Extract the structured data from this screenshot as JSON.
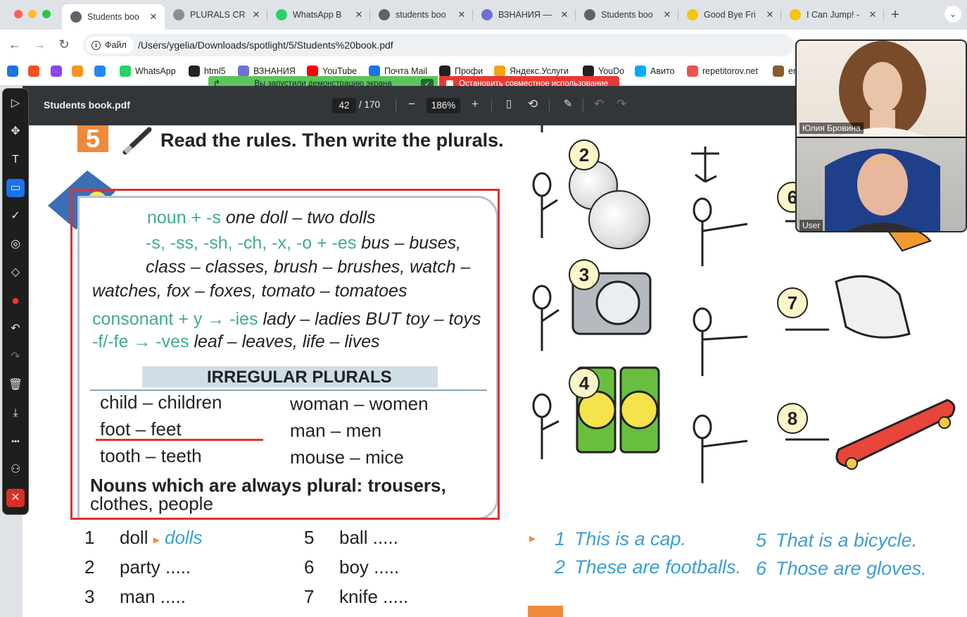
{
  "browser": {
    "tabs": [
      {
        "title": "Students boo",
        "favicon": "globe-icon",
        "color": "#5f6368",
        "active": true
      },
      {
        "title": "PLURALS CR",
        "favicon": "slides-icon",
        "color": "#8a8d91",
        "active": false
      },
      {
        "title": "WhatsApp B",
        "favicon": "whatsapp-icon",
        "color": "#25d366",
        "active": false
      },
      {
        "title": "students boo",
        "favicon": "globe-icon",
        "color": "#5f6368",
        "active": false
      },
      {
        "title": "ВЗНАНИЯ —",
        "favicon": "vznaniya-icon",
        "color": "#6f6fd8",
        "active": false
      },
      {
        "title": "Students boo",
        "favicon": "globe-icon",
        "color": "#5f6368",
        "active": false
      },
      {
        "title": "Good Bye Fri",
        "favicon": "play-icon",
        "color": "#f6c400",
        "active": false
      },
      {
        "title": "I Can Jump! -",
        "favicon": "play-icon",
        "color": "#f6c400",
        "active": false
      }
    ],
    "new_tab": "+",
    "tab_menu": "⌄",
    "address": {
      "chip_label": "Файл",
      "url": "/Users/ygelia/Downloads/spotlight/5/Students%20book.pdf"
    },
    "bookmarks": [
      {
        "label": "",
        "icon": "mail-icon",
        "color": "#1a73e8"
      },
      {
        "label": "",
        "icon": "envelope-icon",
        "color": "#f4511e"
      },
      {
        "label": "",
        "icon": "sparkle-icon",
        "color": "#8e44ef"
      },
      {
        "label": "",
        "icon": "ok-icon",
        "color": "#f7931e"
      },
      {
        "label": "",
        "icon": "vk-icon",
        "color": "#2787f5"
      },
      {
        "label": "WhatsApp",
        "icon": "whatsapp-icon",
        "color": "#25d366"
      },
      {
        "label": "html5",
        "icon": "c-icon",
        "color": "#222222"
      },
      {
        "label": "ВЗНАНИЯ",
        "icon": "vznaniya-icon",
        "color": "#6f6fd8"
      },
      {
        "label": "YouTube",
        "icon": "youtube-icon",
        "color": "#ff0000"
      },
      {
        "label": "Почта Mail",
        "icon": "mail-icon",
        "color": "#1a73e8"
      },
      {
        "label": "Профи",
        "icon": "profi-icon",
        "color": "#222222"
      },
      {
        "label": "Яндекс.Услуги",
        "icon": "yandex-icon",
        "color": "#f2a30f"
      },
      {
        "label": "YouDo",
        "icon": "youdo-icon",
        "color": "#222222"
      },
      {
        "label": "Авито",
        "icon": "avito-icon",
        "color": "#00aaff"
      },
      {
        "label": "repetitorov.net",
        "icon": "dot-icon",
        "color": "#e8554e"
      },
      {
        "label": "er",
        "icon": "photo-icon",
        "color": "#8a5a2b"
      }
    ],
    "screen_share": {
      "status": "Вы запустили демонстрацию экрана",
      "stop_label": "Остановить совместное использование"
    }
  },
  "pdf": {
    "filename": "Students book.pdf",
    "page_current": "42",
    "page_total": "/ 170",
    "zoom": "186%",
    "zoom_out": "−",
    "zoom_in": "+"
  },
  "annotation_tools": [
    {
      "name": "select-tool",
      "glyph": "▷"
    },
    {
      "name": "move-tool",
      "glyph": "✥"
    },
    {
      "name": "text-tool",
      "glyph": "T"
    },
    {
      "name": "rectangle-tool",
      "glyph": "▭"
    },
    {
      "name": "check-tool",
      "glyph": "✓"
    },
    {
      "name": "stamp-tool",
      "glyph": "◎"
    },
    {
      "name": "eraser-tool",
      "glyph": "◇"
    },
    {
      "name": "color-tool",
      "glyph": "●"
    },
    {
      "name": "undo-tool",
      "glyph": "↶"
    },
    {
      "name": "redo-tool",
      "glyph": "↷"
    },
    {
      "name": "delete-tool",
      "glyph": "🗑"
    },
    {
      "name": "save-tool",
      "glyph": "⤓"
    },
    {
      "name": "more-tool",
      "glyph": "•••"
    },
    {
      "name": "participant-tool",
      "glyph": "⚇"
    },
    {
      "name": "close-tool",
      "glyph": "✕"
    }
  ],
  "book": {
    "exercise_number": "5",
    "instruction": "Read the rules. Then write the plurals.",
    "rules": [
      {
        "green": "noun + -s",
        "text": " one doll – two dolls"
      },
      {
        "green": "-s, -ss, -sh, -ch, -x, -o + -es",
        "text": " bus – buses,"
      },
      {
        "green": "",
        "text": "class – classes, brush – brushes, watch –"
      },
      {
        "green": "",
        "text": "watches, fox – foxes, tomato – tomatoes"
      },
      {
        "green": "consonant + y → -ies",
        "text": " lady – ladies BUT toy – toys"
      },
      {
        "green": "-f/-fe → -ves",
        "text": " leaf – leaves, life – lives"
      }
    ],
    "irregular_title": "IRREGULAR PLURALS",
    "irregular_left": [
      "child – children",
      "foot – feet",
      "tooth – teeth"
    ],
    "irregular_right": [
      "woman – women",
      "man – men",
      "mouse – mice"
    ],
    "nouns_plural": "Nouns which are always plural: trousers,",
    "nouns_plural_2": "clothes, people",
    "exercise": [
      {
        "num": "1",
        "word": "doll",
        "answer": "dolls"
      },
      {
        "num": "2",
        "word": "party .....",
        "answer": ""
      },
      {
        "num": "3",
        "word": "man .....",
        "answer": ""
      },
      {
        "num": "5",
        "word": "ball .....",
        "answer": ""
      },
      {
        "num": "6",
        "word": "boy .....",
        "answer": ""
      },
      {
        "num": "7",
        "word": "knife .....",
        "answer": ""
      }
    ],
    "pictures": [
      "2",
      "3",
      "4",
      "6",
      "7",
      "8"
    ],
    "sentences": [
      {
        "num": "1",
        "text": "This is a cap."
      },
      {
        "num": "2",
        "text": "These are footballs."
      },
      {
        "num": "5",
        "text": "That is a bicycle."
      },
      {
        "num": "6",
        "text": "Those are gloves."
      }
    ]
  },
  "video": {
    "participant_1": "Юлия Бровина",
    "participant_2": "User"
  },
  "colors": {
    "accent_green": "#43a98f",
    "annotation_red": "#e03030",
    "answer_blue": "#3b9fd3",
    "badge_orange": "#ee8a3a"
  }
}
